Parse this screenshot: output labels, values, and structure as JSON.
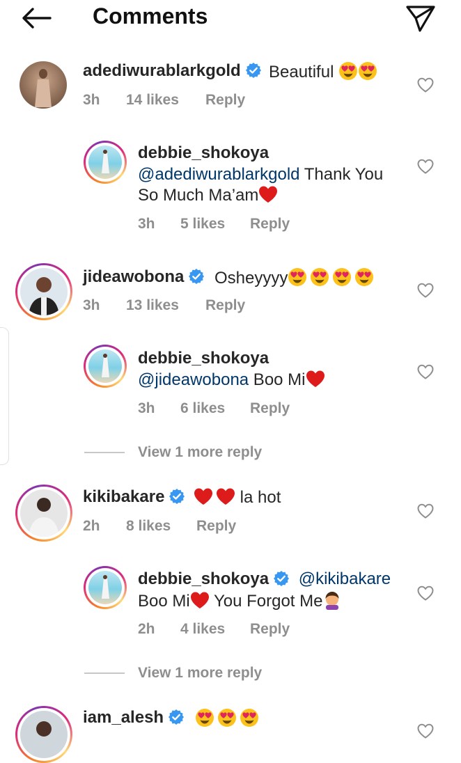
{
  "header": {
    "title": "Comments"
  },
  "comments": [
    {
      "username": "adediwurablarkgold",
      "text": "Beautiful",
      "time": "3h",
      "likes": "14 likes",
      "reply_label": "Reply",
      "reply": {
        "username": "debbie_shokoya",
        "mention": "@adediwurablarkgold",
        "text_line1_rest": " Thank You",
        "text_line2": "So Much Ma’am",
        "time": "3h",
        "likes": "5 likes",
        "reply_label": "Reply"
      }
    },
    {
      "username": "jideawobona",
      "text": "Osheyyyy",
      "time": "3h",
      "likes": "13 likes",
      "reply_label": "Reply",
      "reply": {
        "username": "debbie_shokoya",
        "mention": "@jideawobona",
        "text": " Boo Mi",
        "time": "3h",
        "likes": "6 likes",
        "reply_label": "Reply"
      },
      "view_more": "View 1 more reply"
    },
    {
      "username": "kikibakare",
      "text": " la hot",
      "time": "2h",
      "likes": "8 likes",
      "reply_label": "Reply",
      "reply": {
        "username": "debbie_shokoya",
        "mention": "@kikibakare",
        "text_line2a": "Boo Mi",
        "text_line2b": " You Forgot Me",
        "time": "2h",
        "likes": "4 likes",
        "reply_label": "Reply"
      },
      "view_more": "View 1 more reply"
    },
    {
      "username": "iam_alesh"
    }
  ],
  "colors": {
    "verified": "#3897f0",
    "mention": "#00376b",
    "muted": "#8e8e8e"
  },
  "icons": [
    "back-arrow-icon",
    "send-icon",
    "verified-icon",
    "heart-outline-icon",
    "heart-eyes-emoji",
    "red-heart-emoji",
    "facepalm-emoji"
  ]
}
